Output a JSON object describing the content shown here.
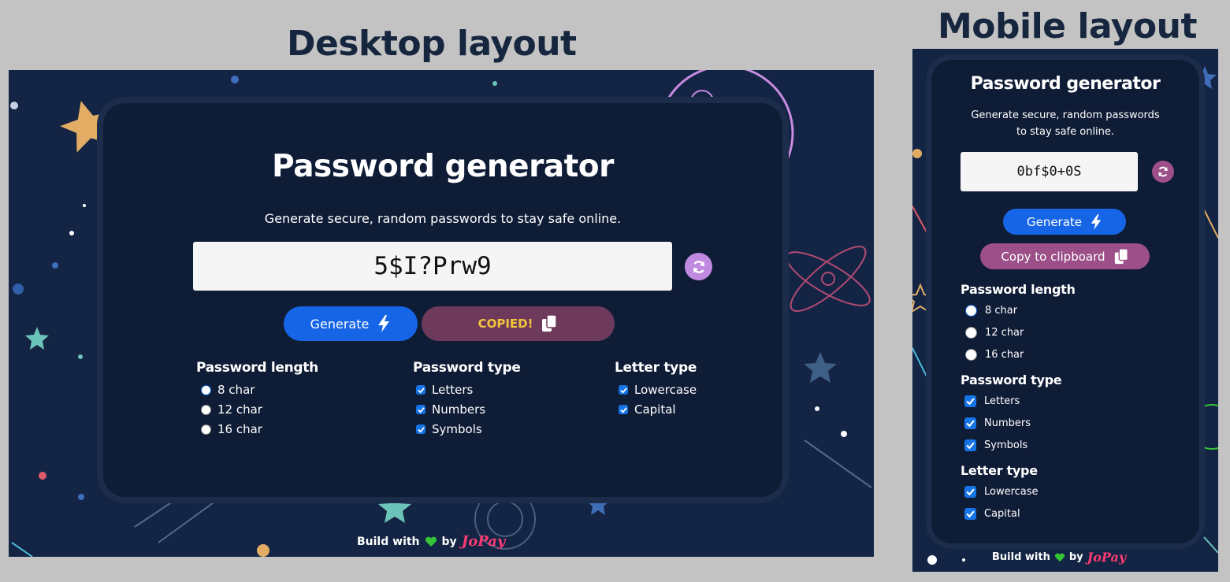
{
  "headings": {
    "desktop": "Desktop layout",
    "mobile": "Mobile layout"
  },
  "desktop": {
    "title": "Password generator",
    "subtitle": "Generate secure, random passwords to stay safe online.",
    "password": "5$I?Prw9",
    "generate_label": "Generate",
    "copy_label": "COPIED!",
    "groups": {
      "length": {
        "title": "Password length",
        "options": [
          "8 char",
          "12 char",
          "16 char"
        ],
        "selected": "8 char"
      },
      "type": {
        "title": "Password type",
        "options": [
          "Letters",
          "Numbers",
          "Symbols"
        ]
      },
      "letter": {
        "title": "Letter type",
        "options": [
          "Lowercase",
          "Capital"
        ]
      }
    },
    "footer": {
      "prefix": "Build with",
      "by": "by",
      "brand": "JoPay"
    }
  },
  "mobile": {
    "title": "Password generator",
    "subtitle_line1": "Generate secure, random passwords",
    "subtitle_line2": "to stay safe online.",
    "password": "0bf$0+0S",
    "generate_label": "Generate",
    "copy_label": "Copy to clipboard",
    "groups": {
      "length": {
        "title": "Password length",
        "options": [
          "8 char",
          "12 char",
          "16 char"
        ],
        "selected": "8 char"
      },
      "type": {
        "title": "Password type",
        "options": [
          "Letters",
          "Numbers",
          "Symbols"
        ]
      },
      "letter": {
        "title": "Letter type",
        "options": [
          "Lowercase",
          "Capital"
        ]
      }
    },
    "footer": {
      "prefix": "Build with",
      "by": "by",
      "brand": "JoPay"
    }
  },
  "icons": [
    "lightning-icon",
    "copy-icon",
    "refresh-icon",
    "green-heart-icon"
  ],
  "colors": {
    "background": "#132444",
    "card": "#0f1c36",
    "generate": "#1565e6",
    "copy": "#9c4f88",
    "copied_text": "#f3c53d",
    "refresh": "#c08ae0",
    "brand": "#ff3b73"
  }
}
